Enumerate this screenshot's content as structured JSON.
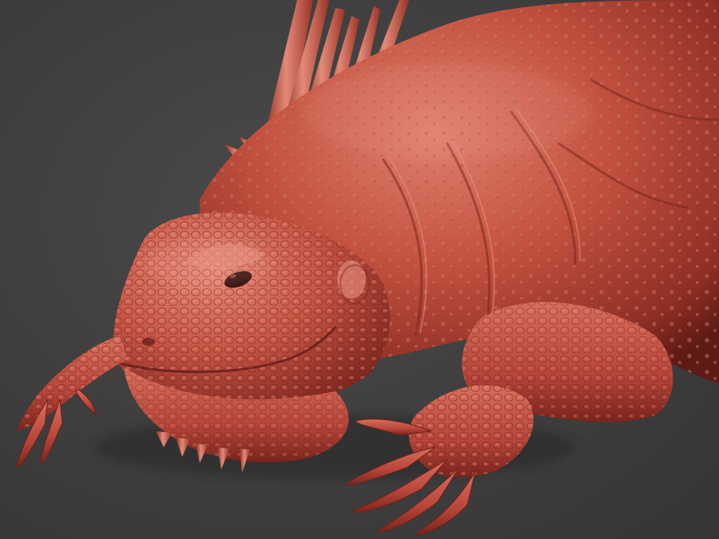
{
  "scene": {
    "subject": "iguana-sculpt",
    "colors": {
      "background": "#3e3e3e",
      "clay_base": "#b8453a",
      "clay_light": "#e07a68",
      "clay_dark": "#6e211b",
      "eye": "#2a0d0a"
    }
  }
}
